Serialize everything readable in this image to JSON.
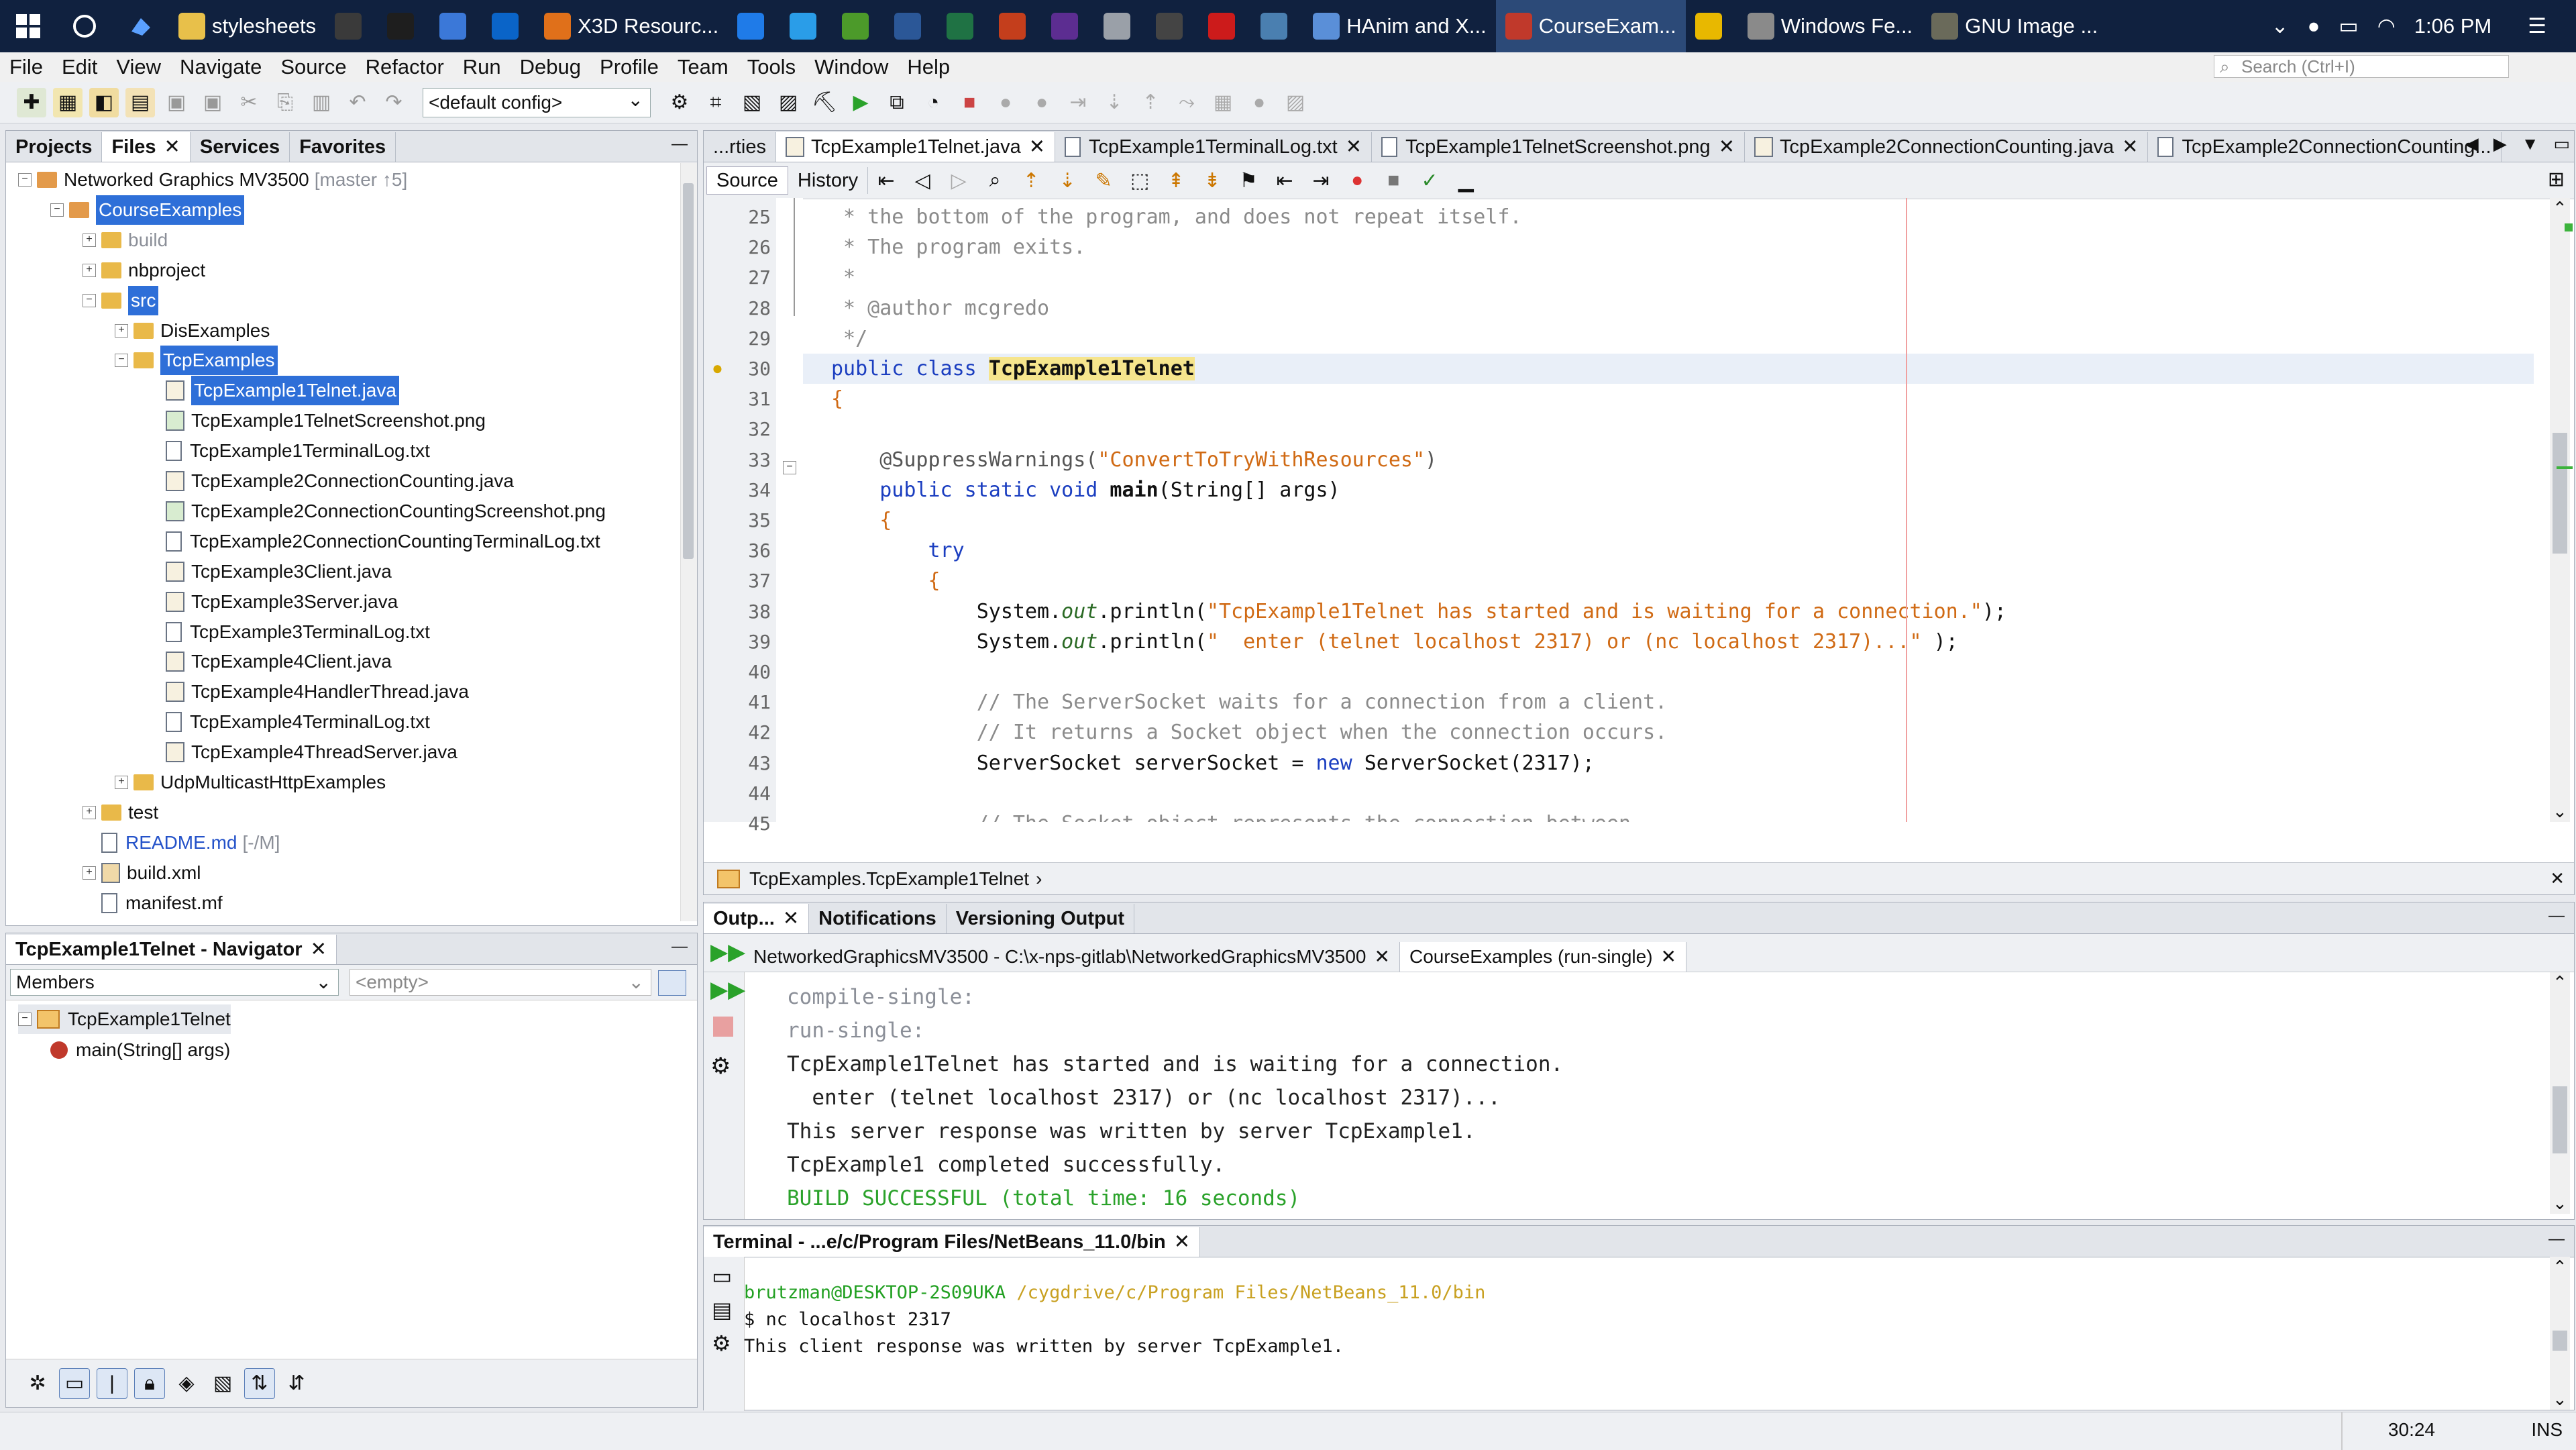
{
  "taskbar": {
    "apps": [
      {
        "label": "stylesheets",
        "color": "#e8c04a"
      },
      {
        "label": "",
        "color": "#3a3a3a"
      },
      {
        "label": "",
        "color": "#1e1e1e"
      },
      {
        "label": "",
        "color": "#3b78d8"
      },
      {
        "label": "",
        "color": "#0a64c8"
      },
      {
        "label": "X3D Resourc...",
        "color": "#e0701a"
      },
      {
        "label": "",
        "color": "#1f7be8"
      },
      {
        "label": "",
        "color": "#2a9de8"
      },
      {
        "label": "",
        "color": "#4c9a2a"
      },
      {
        "label": "",
        "color": "#2b5797"
      },
      {
        "label": "",
        "color": "#1f7244"
      },
      {
        "label": "",
        "color": "#c43e1c"
      },
      {
        "label": "",
        "color": "#5c2d91"
      },
      {
        "label": "",
        "color": "#9aa0a8"
      },
      {
        "label": "",
        "color": "#444444"
      },
      {
        "label": "",
        "color": "#cc1b1b"
      },
      {
        "label": "",
        "color": "#4a7fb0"
      },
      {
        "label": "HAnim and X...",
        "color": "#5a8fd8"
      },
      {
        "label": "CourseExam...",
        "color": "#c0392b",
        "active": true
      },
      {
        "label": "",
        "color": "#e8b800"
      },
      {
        "label": "Windows Fe...",
        "color": "#8a8a8a"
      },
      {
        "label": "GNU Image ...",
        "color": "#6a6a5a"
      }
    ],
    "time": "1:06 PM"
  },
  "menu": [
    "File",
    "Edit",
    "View",
    "Navigate",
    "Source",
    "Refactor",
    "Run",
    "Debug",
    "Profile",
    "Team",
    "Tools",
    "Window",
    "Help"
  ],
  "search_placeholder": "Search (Ctrl+I)",
  "toolbar": {
    "config": "<default config>"
  },
  "projects": {
    "tabs": [
      {
        "label": "Projects",
        "selected": false
      },
      {
        "label": "Files",
        "selected": true,
        "closable": true
      },
      {
        "label": "Services",
        "selected": false
      },
      {
        "label": "Favorites",
        "selected": false
      }
    ],
    "minimize": "—",
    "tree": [
      {
        "depth": 0,
        "label": "Networked Graphics MV3500",
        "suffix": "[master ↑5]",
        "type": "project",
        "exp": "-"
      },
      {
        "depth": 1,
        "label": "CourseExamples",
        "type": "project",
        "exp": "-",
        "hl": true
      },
      {
        "depth": 2,
        "label": "build",
        "type": "folder",
        "exp": "+",
        "muted": true
      },
      {
        "depth": 2,
        "label": "nbproject",
        "type": "folder",
        "exp": "+"
      },
      {
        "depth": 2,
        "label": "src",
        "type": "folder",
        "exp": "-",
        "hl": true
      },
      {
        "depth": 3,
        "label": "DisExamples",
        "type": "folder",
        "exp": "+"
      },
      {
        "depth": 3,
        "label": "TcpExamples",
        "type": "folder",
        "exp": "-",
        "hl": true
      },
      {
        "depth": 4,
        "label": "TcpExample1Telnet.java",
        "type": "java",
        "hl": true
      },
      {
        "depth": 4,
        "label": "TcpExample1TelnetScreenshot.png",
        "type": "image"
      },
      {
        "depth": 4,
        "label": "TcpExample1TerminalLog.txt",
        "type": "file"
      },
      {
        "depth": 4,
        "label": "TcpExample2ConnectionCounting.java",
        "type": "java"
      },
      {
        "depth": 4,
        "label": "TcpExample2ConnectionCountingScreenshot.png",
        "type": "image"
      },
      {
        "depth": 4,
        "label": "TcpExample2ConnectionCountingTerminalLog.txt",
        "type": "file"
      },
      {
        "depth": 4,
        "label": "TcpExample3Client.java",
        "type": "java"
      },
      {
        "depth": 4,
        "label": "TcpExample3Server.java",
        "type": "java"
      },
      {
        "depth": 4,
        "label": "TcpExample3TerminalLog.txt",
        "type": "file"
      },
      {
        "depth": 4,
        "label": "TcpExample4Client.java",
        "type": "java"
      },
      {
        "depth": 4,
        "label": "TcpExample4HandlerThread.java",
        "type": "java"
      },
      {
        "depth": 4,
        "label": "TcpExample4TerminalLog.txt",
        "type": "file"
      },
      {
        "depth": 4,
        "label": "TcpExample4ThreadServer.java",
        "type": "java"
      },
      {
        "depth": 3,
        "label": "UdpMulticastHttpExamples",
        "type": "folder",
        "exp": "+"
      },
      {
        "depth": 2,
        "label": "test",
        "type": "folder",
        "exp": "+"
      },
      {
        "depth": 2,
        "label": "README.md",
        "suffix": "[-/M]",
        "type": "file",
        "blue": true
      },
      {
        "depth": 2,
        "label": "build.xml",
        "type": "xml",
        "exp": "+"
      },
      {
        "depth": 2,
        "label": "manifest.mf",
        "type": "file"
      }
    ]
  },
  "navigator": {
    "title": "TcpExample1Telnet - Navigator",
    "members_label": "Members",
    "filter_placeholder": "<empty>",
    "tree": [
      {
        "label": "TcpExample1Telnet",
        "type": "class"
      },
      {
        "label": "main(String[] args)",
        "type": "method"
      }
    ]
  },
  "editor": {
    "tabs": [
      {
        "label": "...rties",
        "closable": false
      },
      {
        "label": "TcpExample1Telnet.java",
        "closable": true,
        "selected": true
      },
      {
        "label": "TcpExample1TerminalLog.txt",
        "closable": true
      },
      {
        "label": "TcpExample1TelnetScreenshot.png",
        "closable": true
      },
      {
        "label": "TcpExample2ConnectionCounting.java",
        "closable": true
      },
      {
        "label": "TcpExample2ConnectionCounting..."
      }
    ],
    "source_tab": "Source",
    "history_tab": "History",
    "breadcrumb": "TcpExamples.TcpExample1Telnet",
    "lines": [
      {
        "n": "25",
        "code": [
          {
            "t": " * the bottom of the program, and does not repeat itself.",
            "c": "cm"
          }
        ]
      },
      {
        "n": "26",
        "code": [
          {
            "t": " * The program exits.",
            "c": "cm"
          }
        ]
      },
      {
        "n": "27",
        "code": [
          {
            "t": " *",
            "c": "cm"
          }
        ]
      },
      {
        "n": "28",
        "code": [
          {
            "t": " * @author mcgredo",
            "c": "cm"
          }
        ]
      },
      {
        "n": "29",
        "code": [
          {
            "t": " */",
            "c": "cm"
          }
        ]
      },
      {
        "n": "30",
        "code": [
          {
            "t": "public class ",
            "c": "kw"
          },
          {
            "t": "TcpExample1Telnet",
            "c": "cls"
          }
        ],
        "current": true
      },
      {
        "n": "31",
        "code": [
          {
            "t": "{",
            "c": "str"
          }
        ]
      },
      {
        "n": "32",
        "code": []
      },
      {
        "n": "33",
        "code": [
          {
            "t": "    @SuppressWarnings(",
            "c": "ann"
          },
          {
            "t": "\"ConvertToTryWithResources\"",
            "c": "str"
          },
          {
            "t": ")",
            "c": "ann"
          }
        ]
      },
      {
        "n": "34",
        "code": [
          {
            "t": "    public static void ",
            "c": "kw"
          },
          {
            "t": "main",
            "c": "fn"
          },
          {
            "t": "(String[] args)",
            "c": ""
          }
        ]
      },
      {
        "n": "35",
        "code": [
          {
            "t": "    {",
            "c": "str"
          }
        ]
      },
      {
        "n": "36",
        "code": [
          {
            "t": "        try",
            "c": "kw"
          }
        ]
      },
      {
        "n": "37",
        "code": [
          {
            "t": "        {",
            "c": "str"
          }
        ]
      },
      {
        "n": "38",
        "code": [
          {
            "t": "            System.",
            "c": ""
          },
          {
            "t": "out",
            "c": "fld"
          },
          {
            "t": ".println(",
            "c": ""
          },
          {
            "t": "\"TcpExample1Telnet has started and is waiting for a connection.\"",
            "c": "str"
          },
          {
            "t": ");",
            "c": ""
          }
        ]
      },
      {
        "n": "39",
        "code": [
          {
            "t": "            System.",
            "c": ""
          },
          {
            "t": "out",
            "c": "fld"
          },
          {
            "t": ".println(",
            "c": ""
          },
          {
            "t": "\"  enter (telnet localhost 2317) or (nc localhost 2317)...\"",
            "c": "str"
          },
          {
            "t": " );",
            "c": ""
          }
        ]
      },
      {
        "n": "40",
        "code": []
      },
      {
        "n": "41",
        "code": [
          {
            "t": "            // The ServerSocket waits for a connection from a client.",
            "c": "cm"
          }
        ]
      },
      {
        "n": "42",
        "code": [
          {
            "t": "            // It returns a Socket object when the connection occurs.",
            "c": "cm"
          }
        ]
      },
      {
        "n": "43",
        "code": [
          {
            "t": "            ServerSocket serverSocket = ",
            "c": ""
          },
          {
            "t": "new ",
            "c": "kw"
          },
          {
            "t": "ServerSocket(2317);",
            "c": ""
          }
        ]
      },
      {
        "n": "44",
        "code": []
      },
      {
        "n": "45",
        "code": [
          {
            "t": "            // The Socket object represents the connection between",
            "c": "cm"
          }
        ]
      }
    ]
  },
  "output": {
    "tabs": [
      {
        "label": "Outp...",
        "closable": true,
        "selected": true
      },
      {
        "label": "Notifications"
      },
      {
        "label": "Versioning Output"
      }
    ],
    "subtabs": [
      {
        "label": "NetworkedGraphicsMV3500 - C:\\x-nps-gitlab\\NetworkedGraphicsMV3500",
        "closable": true
      },
      {
        "label": "CourseExamples (run-single)",
        "closable": true,
        "selected": true
      }
    ],
    "lines": [
      {
        "t": "compile-single:",
        "c": "muted"
      },
      {
        "t": "run-single:",
        "c": "muted"
      },
      {
        "t": "TcpExample1Telnet has started and is waiting for a connection.",
        "c": ""
      },
      {
        "t": "  enter (telnet localhost 2317) or (nc localhost 2317)...",
        "c": ""
      },
      {
        "t": "This server response was written by server TcpExample1.",
        "c": ""
      },
      {
        "t": "TcpExample1 completed successfully.",
        "c": ""
      },
      {
        "t": "BUILD SUCCESSFUL (total time: 16 seconds)",
        "c": "green"
      }
    ]
  },
  "terminal": {
    "title": "Terminal - ...e/c/Program Files/NetBeans_11.0/bin",
    "prompt_user": "brutzman@DESKTOP-2S09UKA",
    "prompt_path": "/cygdrive/c/Program Files/NetBeans_11.0/bin",
    "command": "$ nc localhost 2317",
    "response": "This client response was written by server TcpExample1."
  },
  "status": {
    "position": "30:24",
    "mode": "INS"
  },
  "colors": {
    "selection": "#2e6fd8",
    "green_text": "#2aa22a",
    "terminal_green": "#22a022",
    "terminal_path": "#c8a020"
  }
}
